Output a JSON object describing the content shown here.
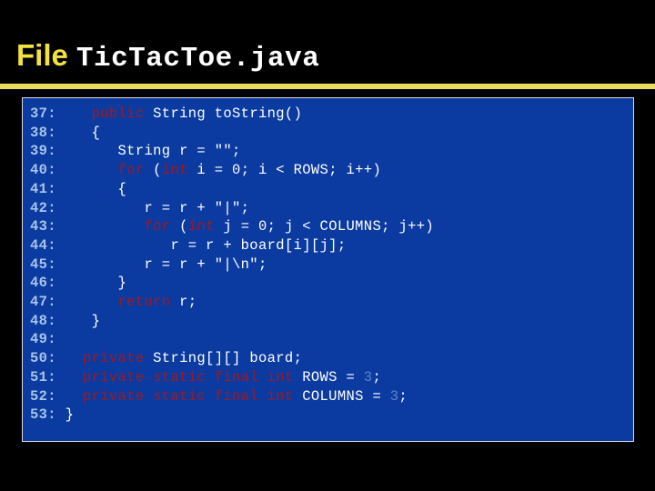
{
  "slide": {
    "title": {
      "prefix": "File",
      "filename": "TicTacToe.java"
    },
    "accent_colors": {
      "title_prefix": "#f2e23c",
      "rule": "#e8dc5a",
      "code_background": "#0b3ba0",
      "code_border": "#d9d9d9",
      "line_number": "#a8c4ea",
      "keyword": "#9e1a22",
      "number_literal": "#5b86c4",
      "plain_text": "#ffffff",
      "slide_background": "#000000"
    },
    "code": {
      "language": "java",
      "first_line": 37,
      "last_line": 53,
      "lines": [
        {
          "number": "37:",
          "tokens": [
            {
              "t": "plain",
              "v": "    "
            },
            {
              "t": "keyword",
              "v": "public"
            },
            {
              "t": "plain",
              "v": " String toString()"
            }
          ]
        },
        {
          "number": "38:",
          "tokens": [
            {
              "t": "plain",
              "v": "    {"
            }
          ]
        },
        {
          "number": "39:",
          "tokens": [
            {
              "t": "plain",
              "v": "       String r = \"\";"
            }
          ]
        },
        {
          "number": "40:",
          "tokens": [
            {
              "t": "plain",
              "v": "       "
            },
            {
              "t": "keyword",
              "v": "for"
            },
            {
              "t": "plain",
              "v": " ("
            },
            {
              "t": "keyword",
              "v": "int"
            },
            {
              "t": "plain",
              "v": " i = 0; i < ROWS; i++)"
            }
          ]
        },
        {
          "number": "41:",
          "tokens": [
            {
              "t": "plain",
              "v": "       {"
            }
          ]
        },
        {
          "number": "42:",
          "tokens": [
            {
              "t": "plain",
              "v": "          r = r + \"|\";"
            }
          ]
        },
        {
          "number": "43:",
          "tokens": [
            {
              "t": "plain",
              "v": "          "
            },
            {
              "t": "keyword",
              "v": "for"
            },
            {
              "t": "plain",
              "v": " ("
            },
            {
              "t": "keyword",
              "v": "int"
            },
            {
              "t": "plain",
              "v": " j = 0; j < COLUMNS; j++)"
            }
          ]
        },
        {
          "number": "44:",
          "tokens": [
            {
              "t": "plain",
              "v": "             r = r + board[i][j];"
            }
          ]
        },
        {
          "number": "45:",
          "tokens": [
            {
              "t": "plain",
              "v": "          r = r + \"|\\n\";"
            }
          ]
        },
        {
          "number": "46:",
          "tokens": [
            {
              "t": "plain",
              "v": "       }"
            }
          ]
        },
        {
          "number": "47:",
          "tokens": [
            {
              "t": "plain",
              "v": "       "
            },
            {
              "t": "keyword",
              "v": "return"
            },
            {
              "t": "plain",
              "v": " r;"
            }
          ]
        },
        {
          "number": "48:",
          "tokens": [
            {
              "t": "plain",
              "v": "    }"
            }
          ]
        },
        {
          "number": "49:",
          "tokens": [
            {
              "t": "plain",
              "v": ""
            }
          ]
        },
        {
          "number": "50:",
          "tokens": [
            {
              "t": "plain",
              "v": "   "
            },
            {
              "t": "keyword",
              "v": "private"
            },
            {
              "t": "plain",
              "v": " String[][] board;"
            }
          ]
        },
        {
          "number": "51:",
          "tokens": [
            {
              "t": "plain",
              "v": "   "
            },
            {
              "t": "keyword",
              "v": "private static final int"
            },
            {
              "t": "plain",
              "v": " ROWS = "
            },
            {
              "t": "number",
              "v": "3"
            },
            {
              "t": "plain",
              "v": ";"
            }
          ]
        },
        {
          "number": "52:",
          "tokens": [
            {
              "t": "plain",
              "v": "   "
            },
            {
              "t": "keyword",
              "v": "private static final int"
            },
            {
              "t": "plain",
              "v": " COLUMNS = "
            },
            {
              "t": "number",
              "v": "3"
            },
            {
              "t": "plain",
              "v": ";"
            }
          ]
        },
        {
          "number": "53:",
          "tokens": [
            {
              "t": "plain",
              "v": " }"
            }
          ]
        }
      ]
    }
  }
}
